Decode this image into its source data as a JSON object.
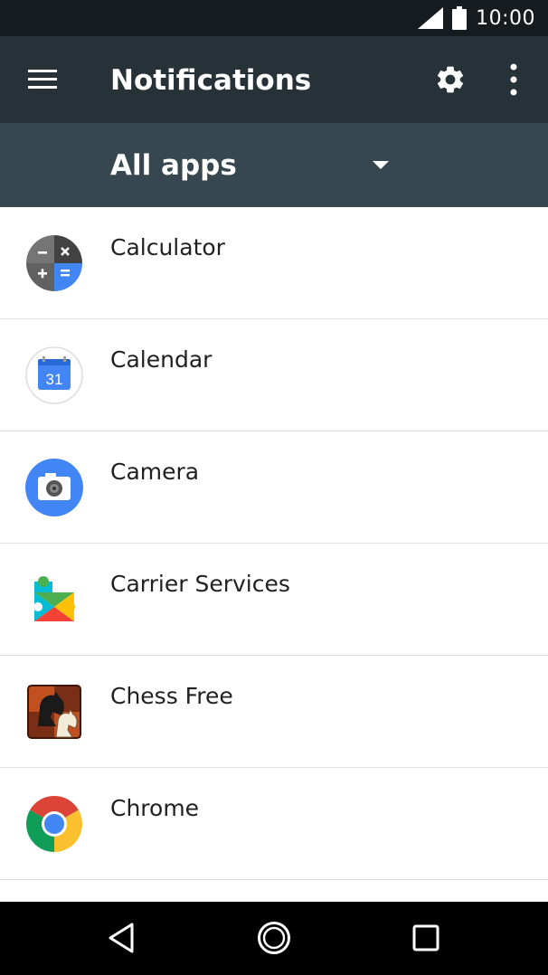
{
  "status_bar": {
    "time": "10:00",
    "icons": [
      "signal-icon",
      "battery-icon"
    ]
  },
  "toolbar": {
    "title": "Notifications",
    "icons": [
      "hamburger-menu-icon",
      "gear-icon",
      "more-vert-icon"
    ]
  },
  "filter": {
    "selected": "All apps"
  },
  "apps": [
    {
      "name": "Calculator",
      "icon": "calculator-icon"
    },
    {
      "name": "Calendar",
      "icon": "calendar-icon",
      "icon_text": "31"
    },
    {
      "name": "Camera",
      "icon": "camera-icon"
    },
    {
      "name": "Carrier Services",
      "icon": "carrier-services-icon"
    },
    {
      "name": "Chess Free",
      "icon": "chess-free-icon"
    },
    {
      "name": "Chrome",
      "icon": "chrome-icon"
    }
  ],
  "nav_bar": {
    "icons": [
      "back-icon",
      "home-icon",
      "recents-icon"
    ]
  },
  "colors": {
    "status_bar": "#151b1f",
    "toolbar": "#263238",
    "filter_bar": "#37474f",
    "divider": "#e0e0e0",
    "nav_bar": "#000000"
  }
}
